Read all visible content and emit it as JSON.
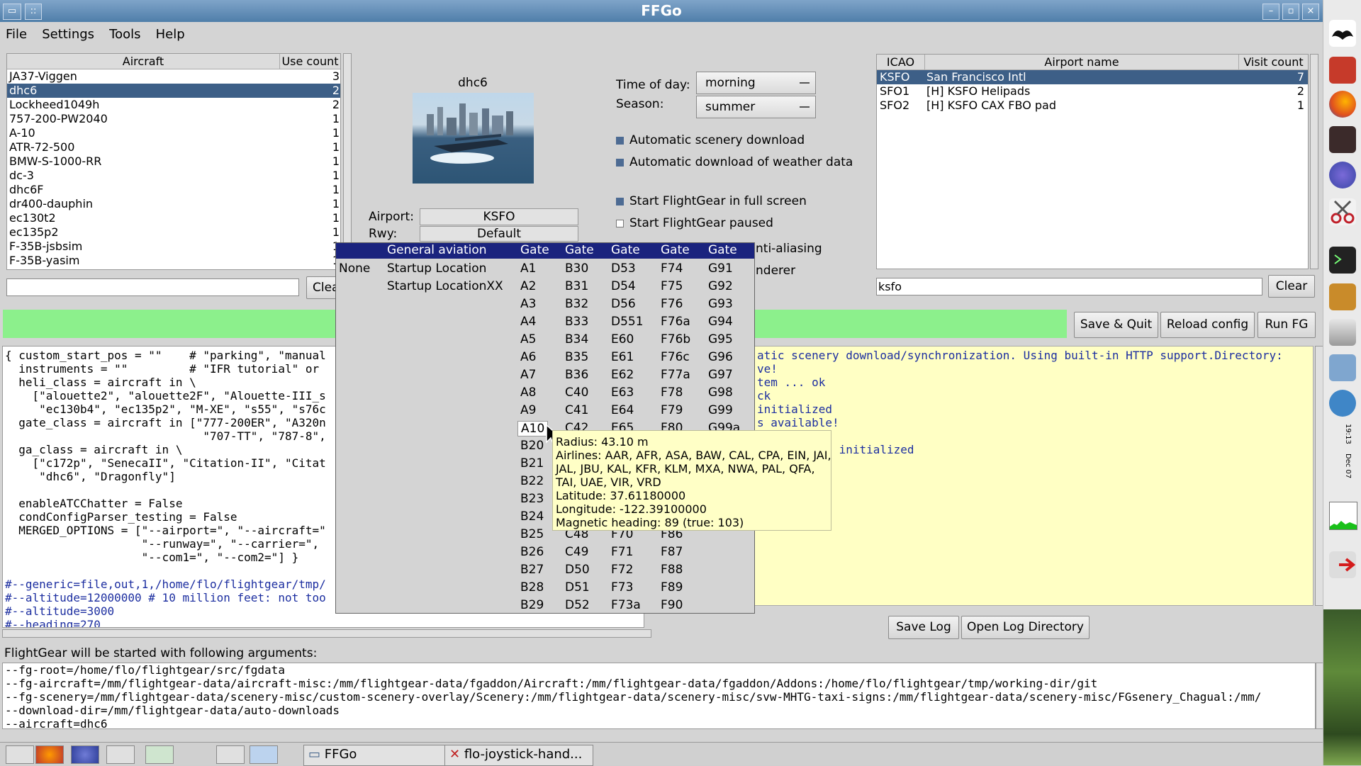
{
  "window": {
    "title": "FFGo"
  },
  "menu": [
    "File",
    "Settings",
    "Tools",
    "Help"
  ],
  "aircraft_list": {
    "headers": [
      "Aircraft",
      "Use count"
    ],
    "rows": [
      [
        "JA37-Viggen",
        "3"
      ],
      [
        "dhc6",
        "2"
      ],
      [
        "Lockheed1049h",
        "2"
      ],
      [
        "757-200-PW2040",
        "1"
      ],
      [
        "A-10",
        "1"
      ],
      [
        "ATR-72-500",
        "1"
      ],
      [
        "BMW-S-1000-RR",
        "1"
      ],
      [
        "dc-3",
        "1"
      ],
      [
        "dhc6F",
        "1"
      ],
      [
        "dr400-dauphin",
        "1"
      ],
      [
        "ec130t2",
        "1"
      ],
      [
        "ec135p2",
        "1"
      ],
      [
        "F-35B-jsbsim",
        "1"
      ],
      [
        "F-35B-yasim",
        "1"
      ]
    ],
    "selected_index": 1,
    "search_value": "",
    "clear_label": "Clea"
  },
  "aircraft_preview": {
    "name": "dhc6"
  },
  "airport_form": {
    "airport_label": "Airport:",
    "airport_value": "KSFO",
    "rwy_label": "Rwy:",
    "rwy_value": "Default"
  },
  "options": {
    "time_of_day_label": "Time of day:",
    "time_of_day_value": "morning",
    "season_label": "Season:",
    "season_value": "summer",
    "checks": [
      {
        "label": "Automatic scenery download",
        "checked": true
      },
      {
        "label": "Automatic download of weather data",
        "checked": true
      },
      {
        "label": "Start FlightGear in full screen",
        "checked": true
      },
      {
        "label": "Start FlightGear paused",
        "checked": false
      }
    ],
    "partial_labels": [
      "nti-aliasing",
      "nderer"
    ]
  },
  "airport_list": {
    "headers": [
      "ICAO",
      "Airport name",
      "Visit count"
    ],
    "rows": [
      [
        "KSFO",
        "San Francisco Intl",
        "7"
      ],
      [
        "SFO1",
        "[H] KSFO Helipads",
        "2"
      ],
      [
        "SFO2",
        "[H] KSFO CAX FBO pad",
        "1"
      ]
    ],
    "selected_index": 0,
    "search_value": "ksfo",
    "clear_label": "Clear"
  },
  "buttons": {
    "save_quit": "Save & Quit",
    "reload_config": "Reload config",
    "run_fg": "Run FG",
    "save_log": "Save Log",
    "open_log_dir": "Open Log Directory"
  },
  "config_text": [
    {
      "text": "{ custom_start_pos = \"\"    # \"parking\", \"manual",
      "blue": false
    },
    {
      "text": "  instruments = \"\"         # \"IFR tutorial\" or",
      "blue": false
    },
    {
      "text": "  heli_class = aircraft in \\",
      "blue": false
    },
    {
      "text": "    [\"alouette2\", \"alouette2F\", \"Alouette-III_s",
      "blue": false
    },
    {
      "text": "     \"ec130b4\", \"ec135p2\", \"M-XE\", \"s55\", \"s76c",
      "blue": false
    },
    {
      "text": "  gate_class = aircraft in [\"777-200ER\", \"A320n",
      "blue": false
    },
    {
      "text": "                             \"707-TT\", \"787-8\",",
      "blue": false
    },
    {
      "text": "  ga_class = aircraft in \\",
      "blue": false
    },
    {
      "text": "    [\"c172p\", \"SenecaII\", \"Citation-II\", \"Citat",
      "blue": false
    },
    {
      "text": "     \"dhc6\", \"Dragonfly\"]",
      "blue": false
    },
    {
      "text": "",
      "blue": false
    },
    {
      "text": "  enableATCChatter = False",
      "blue": false
    },
    {
      "text": "  condConfigParser_testing = False",
      "blue": false
    },
    {
      "text": "  MERGED_OPTIONS = [\"--airport=\", \"--aircraft=\"",
      "blue": false
    },
    {
      "text": "                    \"--runway=\", \"--carrier=\",",
      "blue": false
    },
    {
      "text": "                    \"--com1=\", \"--com2=\"] }",
      "blue": false
    },
    {
      "text": "",
      "blue": false
    },
    {
      "text": "#--generic=file,out,1,/home/flo/flightgear/tmp/",
      "blue": true
    },
    {
      "text": "#--altitude=12000000 # 10 million feet: not too",
      "blue": true
    },
    {
      "text": "#--altitude=3000",
      "blue": true
    },
    {
      "text": "#--heading=270",
      "blue": true
    }
  ],
  "log_text": [
    "atic scenery download/synchronization. Using built-in HTTP support.Directory:",
    "ve!",
    "tem ... ok",
    "ck",
    "initialized",
    "s available!",
    "  Check",
    "itter (ELT) initialized",
    "",
    "s done"
  ],
  "args_panel": {
    "label": "FlightGear will be started with following arguments:",
    "lines": [
      "--fg-root=/home/flo/flightgear/src/fgdata",
      "--fg-aircraft=/mm/flightgear-data/aircraft-misc:/mm/flightgear-data/fgaddon/Aircraft:/mm/flightgear-data/fgaddon/Addons:/home/flo/flightgear/tmp/working-dir/git",
      "--fg-scenery=/mm/flightgear-data/scenery-misc/custom-scenery-overlay/Scenery:/mm/flightgear-data/scenery-misc/svw-MHTG-taxi-signs:/mm/flightgear-data/scenery-misc/FGsenery_Chagual:/mm/",
      "--download-dir=/mm/flightgear-data/auto-downloads",
      "--aircraft=dhc6"
    ]
  },
  "parking_popup": {
    "headers": [
      "General aviation",
      "Gate",
      "Gate",
      "Gate",
      "Gate",
      "Gate"
    ],
    "col_none": "None",
    "col_ga": [
      "Startup Location",
      "Startup LocationXX"
    ],
    "col1": [
      "A1",
      "A2",
      "A3",
      "A4",
      "A5",
      "A6",
      "A7",
      "A8",
      "A9",
      "A10",
      "B20",
      "B21",
      "B22",
      "B23",
      "B24",
      "B25",
      "B26",
      "B27",
      "B28",
      "B29"
    ],
    "col2": [
      "B30",
      "B31",
      "B32",
      "B33",
      "B34",
      "B35",
      "B36",
      "C40",
      "C41",
      "C42",
      "",
      "",
      "",
      "",
      "",
      "C48",
      "C49",
      "D50",
      "D51",
      "D52"
    ],
    "col3": [
      "D53",
      "D54",
      "D56",
      "D551",
      "E60",
      "E61",
      "E62",
      "E63",
      "E64",
      "E65",
      "",
      "",
      "",
      "",
      "",
      "F70",
      "F71",
      "F72",
      "F73",
      "F73a"
    ],
    "col4": [
      "F74",
      "F75",
      "F76",
      "F76a",
      "F76b",
      "F76c",
      "F77a",
      "F78",
      "F79",
      "F80",
      "",
      "",
      "",
      "",
      "",
      "F86",
      "F87",
      "F88",
      "F89",
      "F90"
    ],
    "col5": [
      "G91",
      "G92",
      "G93",
      "G94",
      "G95",
      "G96",
      "G97",
      "G98",
      "G99",
      "G99a",
      "",
      "",
      "",
      "",
      "",
      "",
      "",
      "",
      "",
      ""
    ],
    "hover_index": 9
  },
  "tooltip": {
    "lines": [
      "Radius: 43.10 m",
      "Airlines: AAR, AFR, ASA, BAW, CAL, CPA, EIN, JAI,",
      "  JAL, JBU, KAL, KFR, KLM, MXA, NWA, PAL, QFA,",
      "  TAI, UAE, VIR, VRD",
      "Latitude: 37.61180000",
      "Longitude: -122.39100000",
      "Magnetic heading: 89 (true: 103)"
    ]
  },
  "taskbar": {
    "tasks": [
      "FFGo",
      "flo-joystick-hand..."
    ]
  },
  "dock": {
    "clock_time": "19:13",
    "clock_date": "Dec 07"
  },
  "colors": {
    "selection": "#3d5f87",
    "status_green": "#8cf08c",
    "log_bg": "#ffffc4",
    "popup_header": "#1a237e"
  }
}
